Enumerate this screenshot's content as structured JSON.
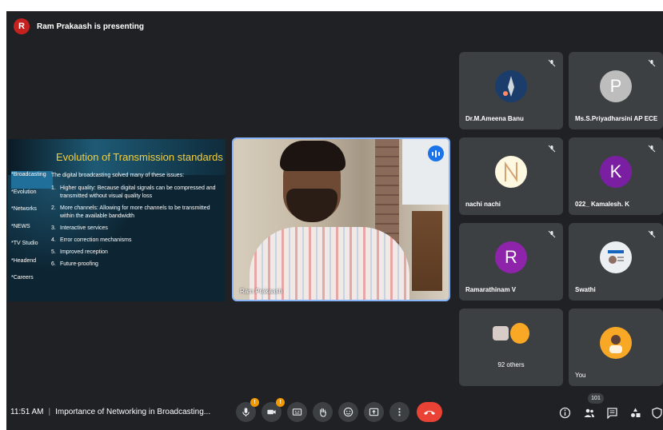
{
  "header": {
    "presenter_initial": "R",
    "presenting_text": "Ram Prakaash is presenting"
  },
  "slide": {
    "title": "Evolution of Transmission standards",
    "sidebar": [
      "*Broadcasting",
      "*Evolution",
      "*Networks",
      "*NEWS",
      "*TV Studio",
      "*Headend",
      "*Careers"
    ],
    "lead": "The digital broadcasting solved many of these issues:",
    "points": [
      {
        "num": "1.",
        "text": "Higher quality: Because digital signals can be compressed and transmitted without visual quality loss"
      },
      {
        "num": "2.",
        "text": "More channels: Allowing for more channels to be transmitted within the available bandwidth"
      },
      {
        "num": "3.",
        "text": "Interactive services"
      },
      {
        "num": "4.",
        "text": "Error correction mechanisms"
      },
      {
        "num": "5.",
        "text": "Improved reception"
      },
      {
        "num": "6.",
        "text": "Future-proofing"
      }
    ]
  },
  "presenter_tile": {
    "name": "Ram Prakaash"
  },
  "participants": [
    {
      "name": "Dr.M.Ameena Banu",
      "avatar": "photo",
      "muted": true
    },
    {
      "name": "Ms.S.Priyadharsini AP ECE",
      "avatar": "P",
      "avatar_color": "#bdbdbd",
      "muted": true
    },
    {
      "name": "nachi nachi",
      "avatar": "photo",
      "muted": true
    },
    {
      "name": "022_ Kamalesh. K",
      "avatar": "K",
      "avatar_color": "#7b1fa2",
      "muted": true
    },
    {
      "name": "Ramarathinam V",
      "avatar": "R",
      "avatar_color": "#8e24aa",
      "muted": true
    },
    {
      "name": "Swathi",
      "avatar": "photo",
      "muted": true
    },
    {
      "name": "92 others",
      "avatar": "group",
      "muted": false
    },
    {
      "name": "You",
      "avatar": "photo",
      "muted": false
    }
  ],
  "bottom_bar": {
    "time": "11:51 AM",
    "meeting_title": "Importance of Networking in Broadcasting...",
    "mic_badge": "!",
    "camera_badge": "!",
    "people_count": "101"
  },
  "icons": {
    "mic": "mic-off-icon",
    "camera": "camera-off-icon",
    "captions": "captions-icon",
    "hand": "raise-hand-icon",
    "emoji": "emoji-icon",
    "present": "present-icon",
    "more": "more-options-icon",
    "end_call": "end-call-icon",
    "info": "info-icon",
    "people": "people-icon",
    "chat": "chat-icon",
    "activities": "activities-icon",
    "host": "host-controls-icon"
  },
  "colors": {
    "background": "#202124",
    "tile": "#3c4043",
    "end_call": "#ea4335",
    "speaking": "#1a73e8",
    "badge": "#f29900"
  }
}
